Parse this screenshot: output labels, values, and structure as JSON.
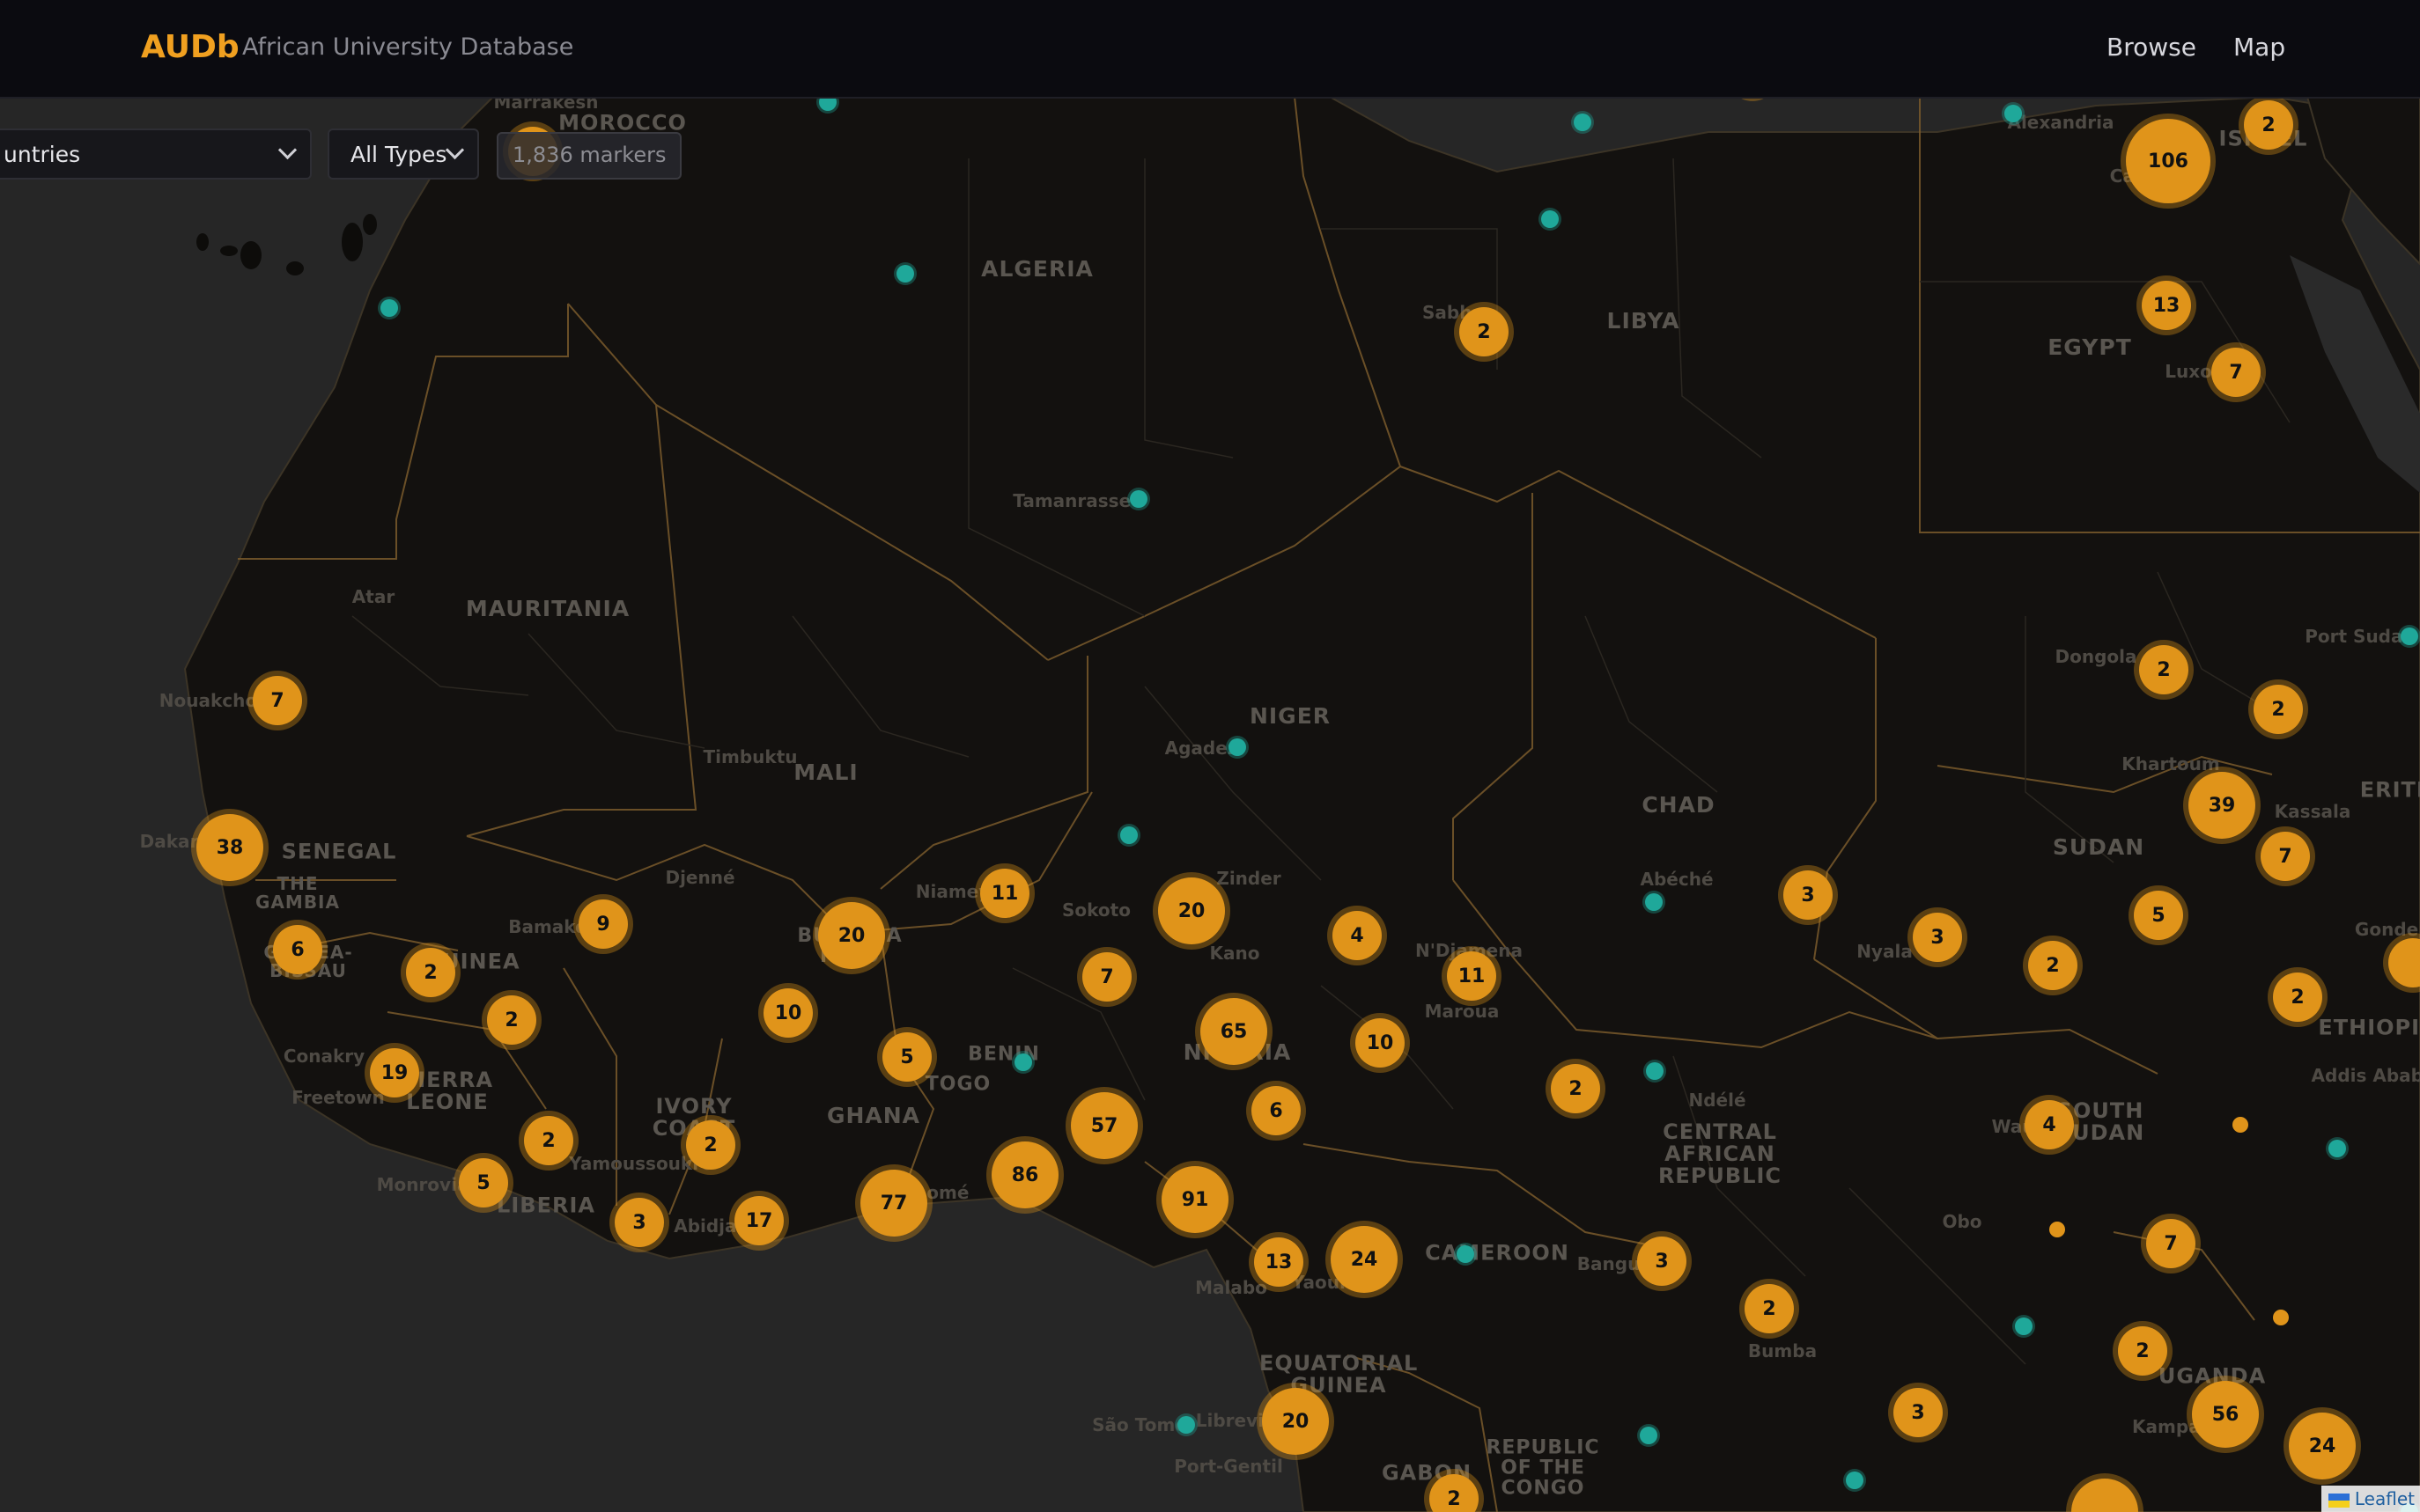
{
  "header": {
    "brand": "AUDb",
    "tagline": "African University Database",
    "nav": [
      "Browse",
      "Map"
    ]
  },
  "filters": {
    "country_select": "untries",
    "type_select": "All Types",
    "marker_count": "1,836 markers"
  },
  "attribution": "Leaflet",
  "colors": {
    "cluster": "#e0941a",
    "single_marker": "#1fa89a",
    "accent": "#f0a020",
    "land": "#13110f",
    "water": "#262626"
  },
  "countries": [
    "MOROCCO",
    "ALGERIA",
    "LIBYA",
    "EGYPT",
    "MAURITANIA",
    "MALI",
    "NIGER",
    "CHAD",
    "SUDAN",
    "SENEGAL",
    "THE GAMBIA",
    "GUINEA-BISSAU",
    "GUINEA",
    "SIERRA LEONE",
    "LIBERIA",
    "IVORY COAST",
    "GHANA",
    "BURKINA FASO",
    "TOGO",
    "BENIN",
    "NIGERIA",
    "CAMEROON",
    "CENTRAL AFRICAN REPUBLIC",
    "SOUTH SUDAN",
    "EQUATORIAL GUINEA",
    "GABON",
    "REPUBLIC OF THE CONGO",
    "UGANDA",
    "ISRAEL",
    "ERITREA",
    "ETHIOPIA"
  ],
  "cities": [
    "Marrakesh",
    "Alexandria",
    "Cairo",
    "Sabha",
    "Luxor",
    "Tamanrasset",
    "Atar",
    "Nouakchott",
    "Timbuktu",
    "Agadez",
    "Dakar",
    "Djenné",
    "Bamako",
    "Niamey",
    "Sokoto",
    "Zinder",
    "Kano",
    "N'Djamena",
    "Abéché",
    "Nyala",
    "Dongola",
    "Port Sudan",
    "Khartoum",
    "Kassala",
    "Gonder",
    "Maroua",
    "Conakry",
    "Freetown",
    "Monrovia",
    "Yamoussoukro",
    "Abidjan",
    "Lomé",
    "Ndélé",
    "Wau",
    "Obo",
    "Bangui",
    "Bumba",
    "Malabo",
    "Yaoundé",
    "Libreville",
    "São Tomé",
    "Port-Gentil",
    "Kampala",
    "Addis Ababa"
  ],
  "clusters": [
    106,
    2,
    13,
    7,
    2,
    7,
    38,
    2,
    39,
    7,
    5,
    2,
    2,
    2,
    4,
    7,
    7,
    3,
    3,
    11,
    20,
    20,
    9,
    6,
    2,
    2,
    10,
    5,
    7,
    65,
    10,
    6,
    11,
    2,
    4,
    19,
    2,
    5,
    2,
    3,
    17,
    77,
    86,
    57,
    91,
    13,
    24,
    3,
    2,
    3,
    2,
    56,
    24,
    20,
    2
  ],
  "single_markers": 20
}
